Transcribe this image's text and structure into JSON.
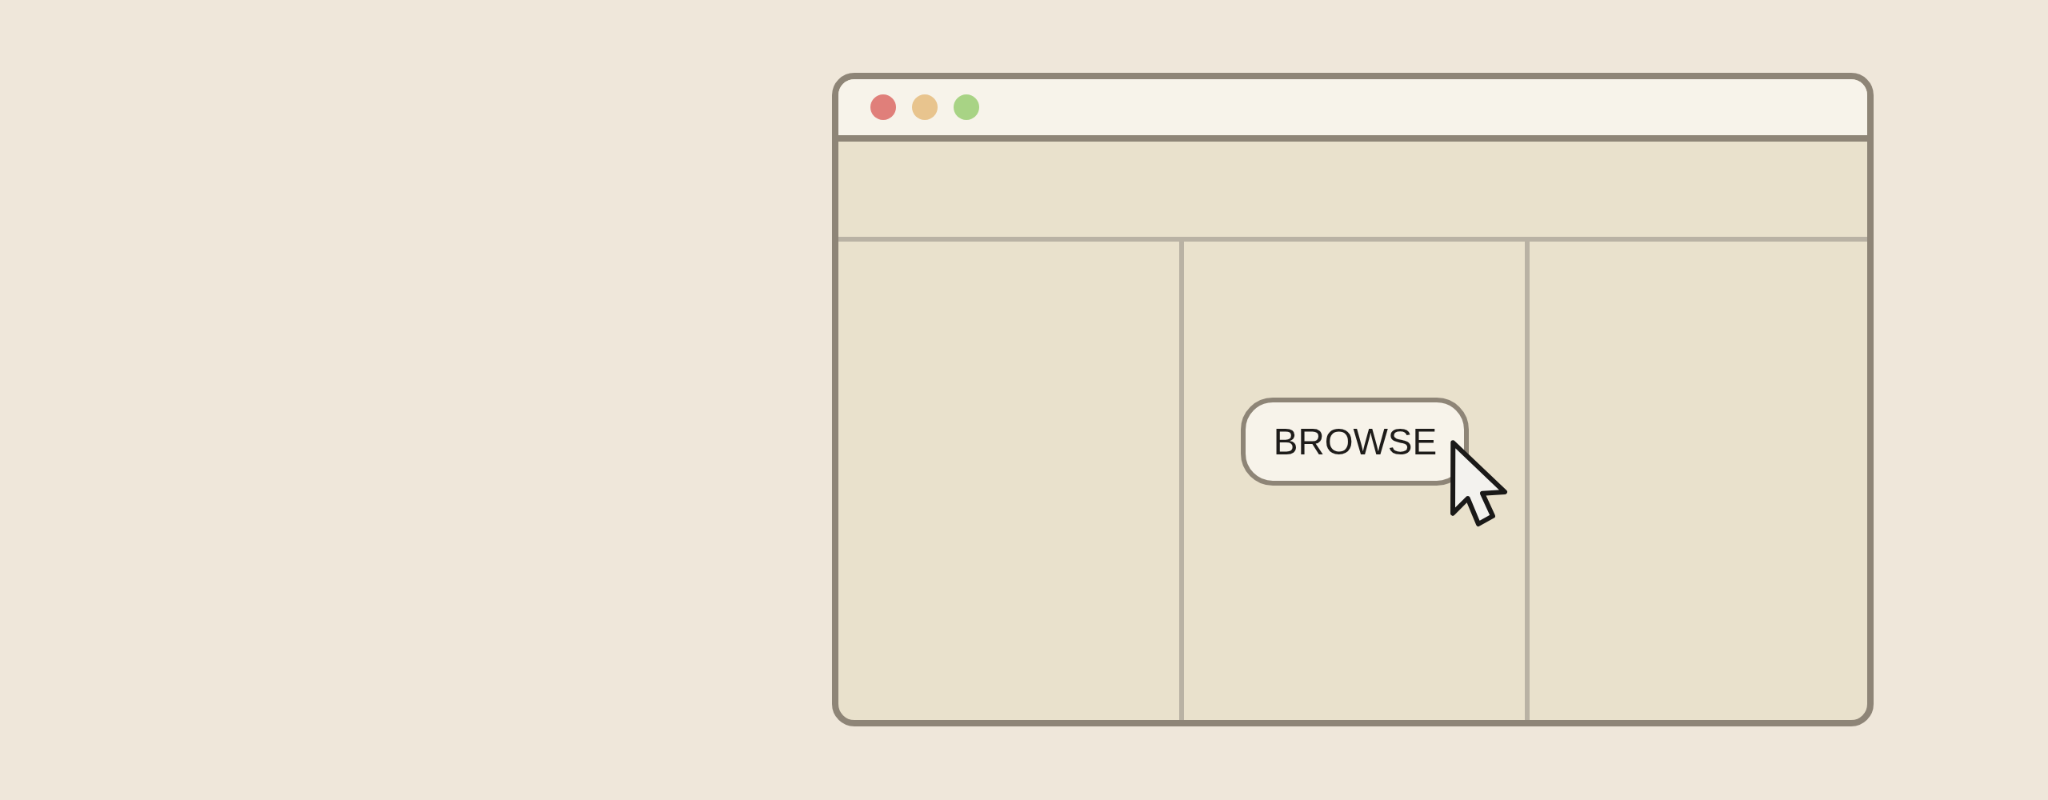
{
  "window": {
    "controls": [
      {
        "color": "#e07f7a"
      },
      {
        "color": "#e8c48e"
      },
      {
        "color": "#a8d385"
      }
    ]
  },
  "content": {
    "button": {
      "label": "BROWSE"
    }
  }
}
